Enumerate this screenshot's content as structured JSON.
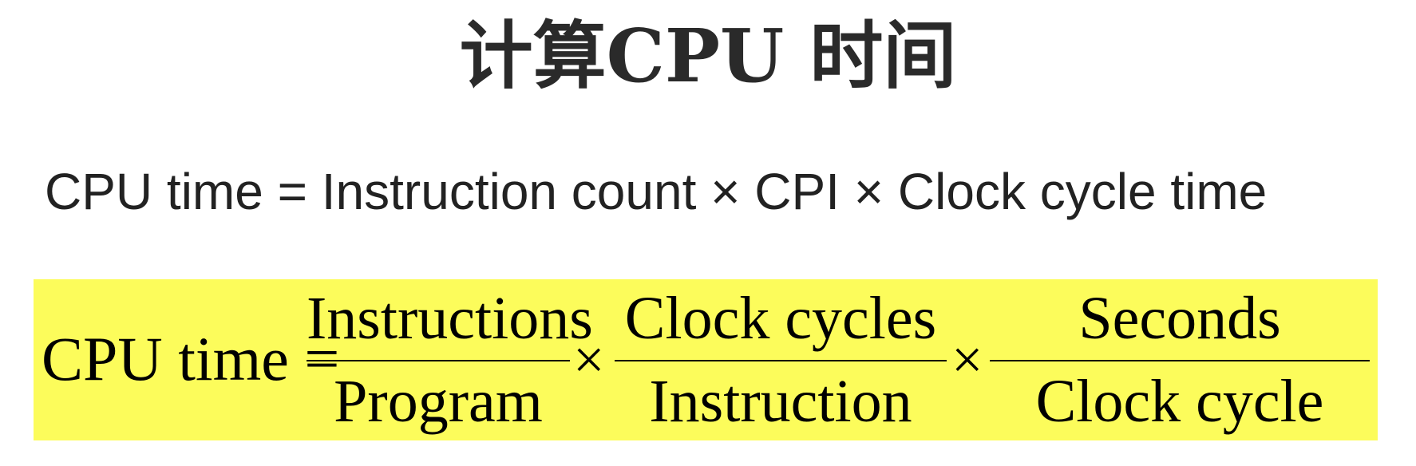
{
  "title": "计算CPU 时间",
  "equation_line": "CPU time = Instruction count × CPI × Clock cycle time",
  "formula": {
    "lhs": "CPU time =",
    "times_symbol": "×",
    "fractions": [
      {
        "numerator": "Instructions",
        "denominator": "Program"
      },
      {
        "numerator": "Clock cycles",
        "denominator": "Instruction"
      },
      {
        "numerator": "Seconds",
        "denominator": "Clock cycle"
      }
    ],
    "highlight_color": "#fcfc5b"
  }
}
